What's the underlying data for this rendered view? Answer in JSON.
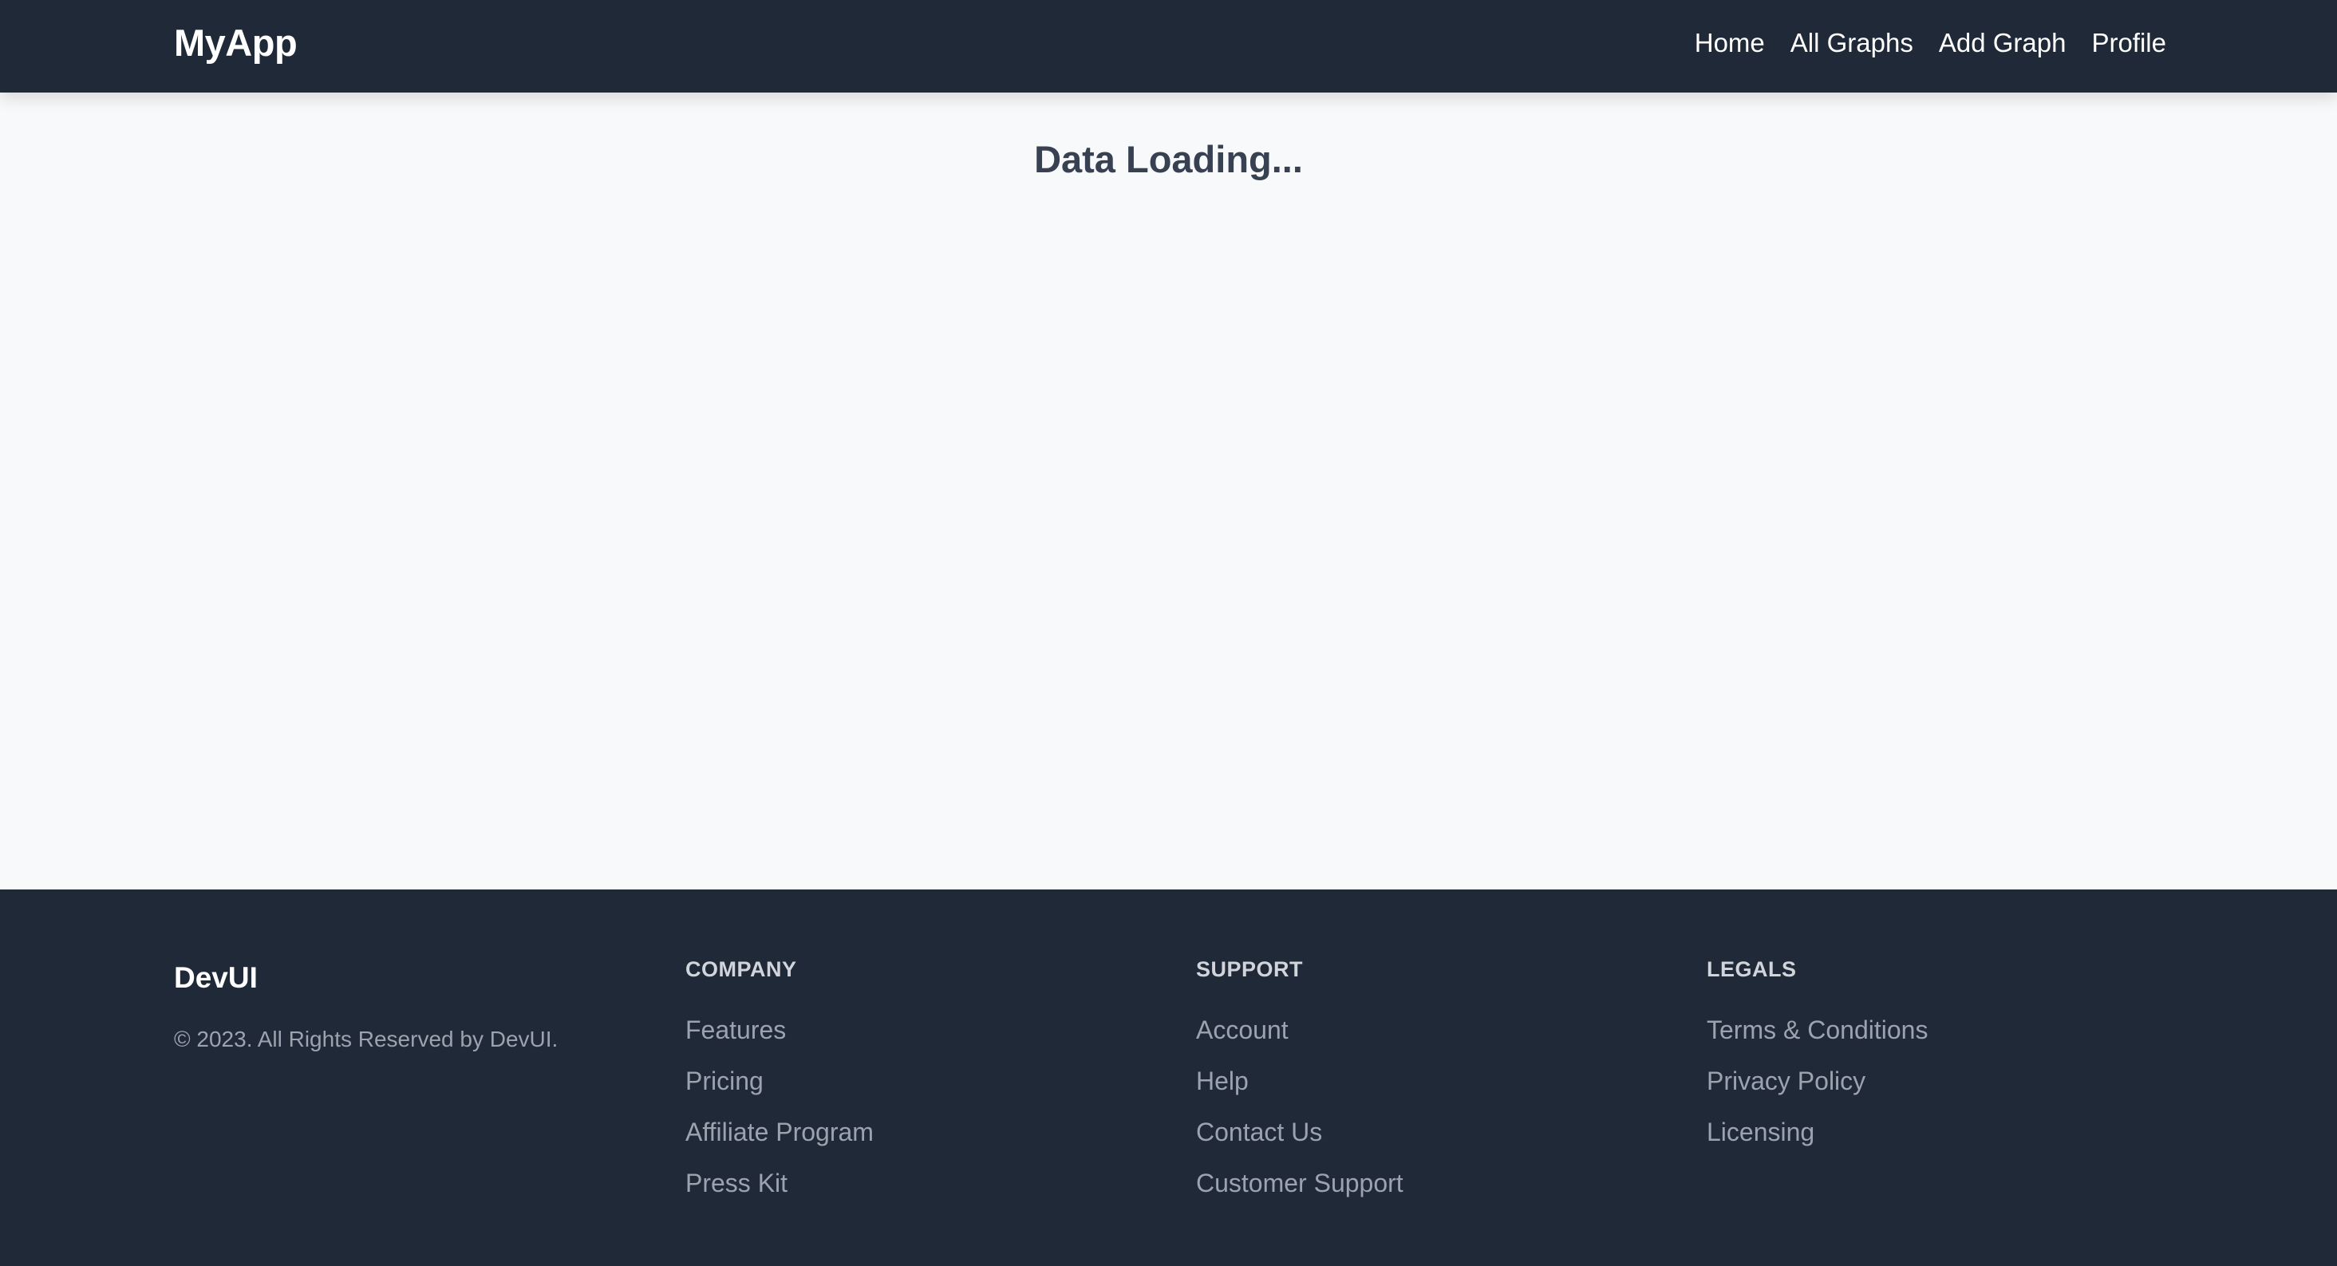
{
  "header": {
    "logo": "MyApp",
    "nav": [
      "Home",
      "All Graphs",
      "Add Graph",
      "Profile"
    ]
  },
  "main": {
    "status": "Data Loading..."
  },
  "footer": {
    "brand": "DevUI",
    "copyright": "© 2023. All Rights Reserved by DevUI.",
    "columns": [
      {
        "title": "COMPANY",
        "links": [
          "Features",
          "Pricing",
          "Affiliate Program",
          "Press Kit"
        ]
      },
      {
        "title": "SUPPORT",
        "links": [
          "Account",
          "Help",
          "Contact Us",
          "Customer Support"
        ]
      },
      {
        "title": "LEGALS",
        "links": [
          "Terms & Conditions",
          "Privacy Policy",
          "Licensing"
        ]
      }
    ]
  },
  "colors": {
    "header_bg": "#1f2937",
    "page_bg": "#f8f9fb",
    "footer_bg": "#1f2937",
    "heading": "#374151",
    "footer_link": "#9ca3af"
  }
}
